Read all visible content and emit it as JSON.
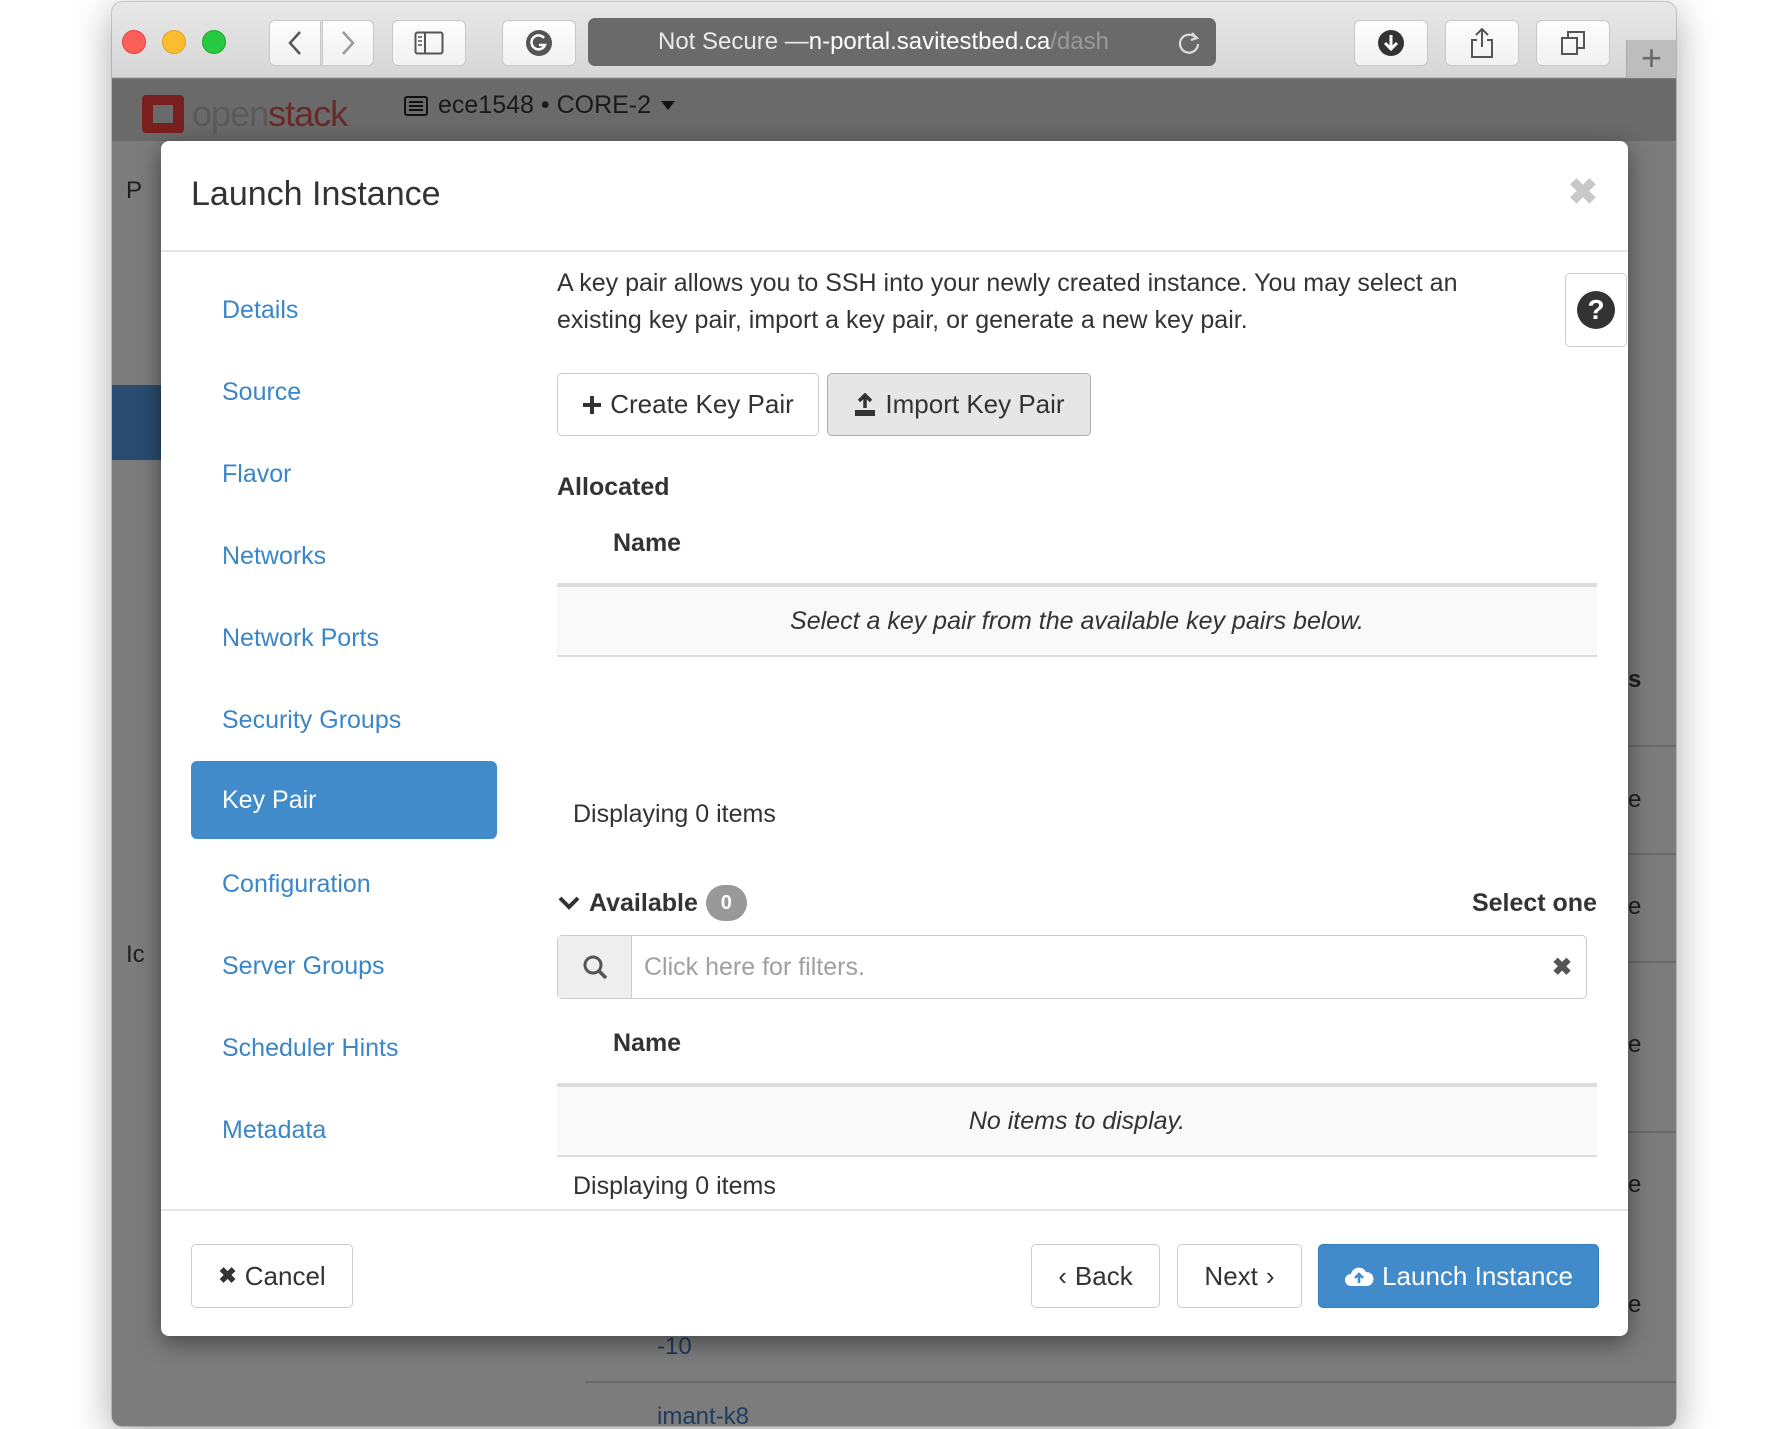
{
  "browser": {
    "address_prefix": "Not Secure — ",
    "address_host": "n-portal.savitestbed.ca",
    "address_path": "/dash",
    "new_tab_label": "+"
  },
  "header": {
    "logo_part1": "open",
    "logo_part2": "stack",
    "project_selector": "ece1548 • CORE-2"
  },
  "background": {
    "page_letter": "P",
    "left_fragment": "Ic",
    "right_fragments": [
      "s",
      "e",
      "e",
      "e",
      "e",
      "e"
    ],
    "row_links": [
      "-10",
      "imant-k8"
    ]
  },
  "modal": {
    "title": "Launch Instance",
    "nav": [
      {
        "label": "Details",
        "active": false
      },
      {
        "label": "Source",
        "active": false
      },
      {
        "label": "Flavor",
        "active": false
      },
      {
        "label": "Networks",
        "active": false
      },
      {
        "label": "Network Ports",
        "active": false
      },
      {
        "label": "Security Groups",
        "active": false
      },
      {
        "label": "Key Pair",
        "active": true
      },
      {
        "label": "Configuration",
        "active": false
      },
      {
        "label": "Server Groups",
        "active": false
      },
      {
        "label": "Scheduler Hints",
        "active": false
      },
      {
        "label": "Metadata",
        "active": false
      }
    ],
    "intro": "A key pair allows you to SSH into your newly created instance. You may select an existing key pair, import a key pair, or generate a new key pair.",
    "create_key_pair": "Create Key Pair",
    "import_key_pair": "Import Key Pair",
    "allocated": {
      "label": "Allocated",
      "column": "Name",
      "empty_message": "Select a key pair from the available key pairs below.",
      "count_text": "Displaying 0 items"
    },
    "available": {
      "label": "Available",
      "count_badge": "0",
      "select_hint": "Select one",
      "filter_placeholder": "Click here for filters.",
      "filter_value": "",
      "column": "Name",
      "empty_message": "No items to display.",
      "count_text": "Displaying 0 items"
    },
    "footer": {
      "cancel": "Cancel",
      "back": "Back",
      "next": "Next",
      "launch": "Launch Instance"
    }
  },
  "colors": {
    "primary": "#428bca",
    "link": "#3a86c7"
  }
}
